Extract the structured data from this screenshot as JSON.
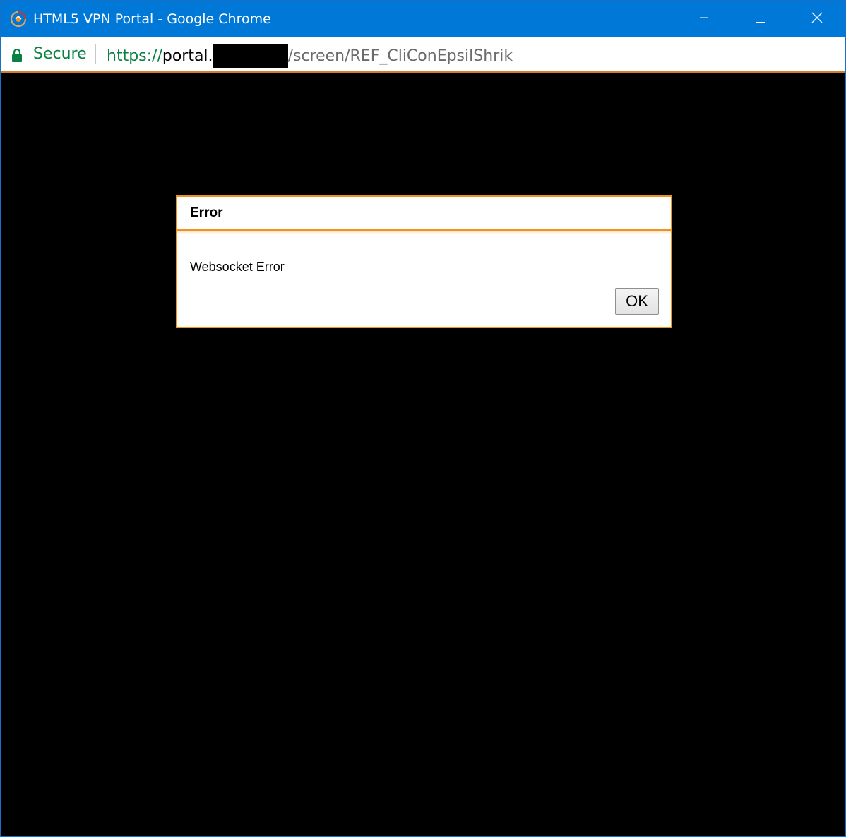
{
  "window": {
    "title": "HTML5 VPN Portal - Google Chrome",
    "titlebar_color": "#0078d7"
  },
  "addressbar": {
    "secure_label": "Secure",
    "url_scheme": "https://",
    "url_host": "portal.",
    "url_path": "/screen/REF_CliConEpsilShrik",
    "secure_color": "#0b8043"
  },
  "dialog": {
    "title": "Error",
    "message": "Websocket Error",
    "ok_label": "OK",
    "accent_color": "#f0921e"
  },
  "icons": {
    "app": "app-logo-icon",
    "lock": "lock-icon",
    "minimize": "minimize-icon",
    "maximize": "maximize-icon",
    "close": "close-icon"
  }
}
